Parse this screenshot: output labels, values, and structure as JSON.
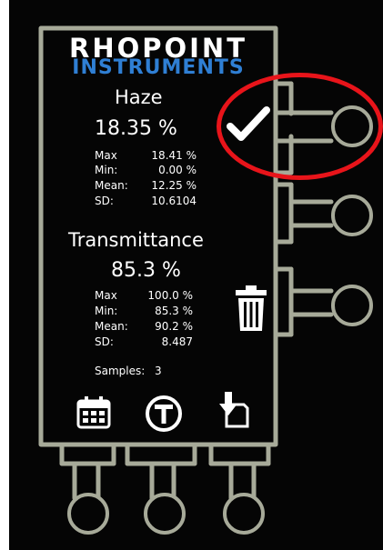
{
  "logo": {
    "line1": "RHOPOINT",
    "line2": "INSTRUMENTS"
  },
  "haze": {
    "title": "Haze",
    "value": "18.35 %",
    "stats": [
      {
        "label": "Max",
        "value": "18.41 %"
      },
      {
        "label": "Min:",
        "value": "0.00 %"
      },
      {
        "label": "Mean:",
        "value": "12.25 %"
      },
      {
        "label": "SD:",
        "value": "10.6104"
      }
    ]
  },
  "transmittance": {
    "title": "Transmittance",
    "value": "85.3 %",
    "stats": [
      {
        "label": "Max",
        "value": "100.0 %"
      },
      {
        "label": "Min:",
        "value": "85.3 %"
      },
      {
        "label": "Mean:",
        "value": "90.2 %"
      },
      {
        "label": "SD:",
        "value": "8.487"
      }
    ]
  },
  "samples": {
    "label": "Samples:",
    "value": "3"
  },
  "icons": {
    "check": "checkmark-icon",
    "trash": "trash-icon",
    "calendar": "calendar-icon",
    "t_circle": "t-circle-icon",
    "download": "download-document-icon"
  },
  "colors": {
    "frame": "#a7aa99",
    "background": "#050505",
    "annotation": "#e8141a",
    "logo_blue": "#2f7fd4"
  }
}
